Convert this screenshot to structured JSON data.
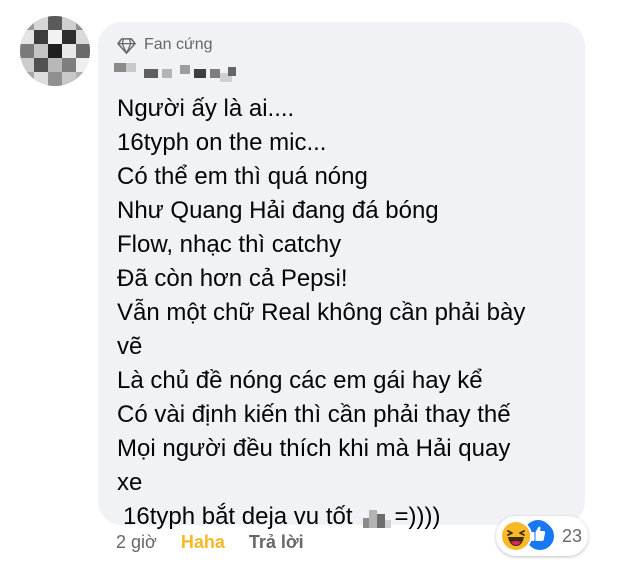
{
  "comment": {
    "badge": "Fan cứng",
    "lines": [
      "Người ấy là ai....",
      "16typh on the mic...",
      "Có thể em thì quá nóng",
      "Như Quang Hải đang đá bóng",
      "Flow, nhạc thì catchy",
      "Đã còn hơn cả Pepsi!",
      "Vẫn một chữ Real không cần phải bày",
      "vẽ",
      "Là chủ đề nóng các em gái hay kể",
      "Có vài định kiến thì cần phải thay thế",
      "Mọi người đều thích khi mà Hải quay",
      "xe"
    ],
    "last_line_start": "16typh bắt deja vu tốt",
    "last_line_end": "=))))"
  },
  "footer": {
    "time": "2 giờ",
    "haha": "Haha",
    "reply": "Trả lời"
  },
  "reactions": {
    "icons": [
      "haha-icon",
      "like-icon"
    ],
    "count": "23"
  },
  "colors": {
    "bubble": "#f0f2f5",
    "text": "#050505",
    "meta": "#65676b",
    "haha": "#f7b928",
    "like": "#1877f2"
  }
}
